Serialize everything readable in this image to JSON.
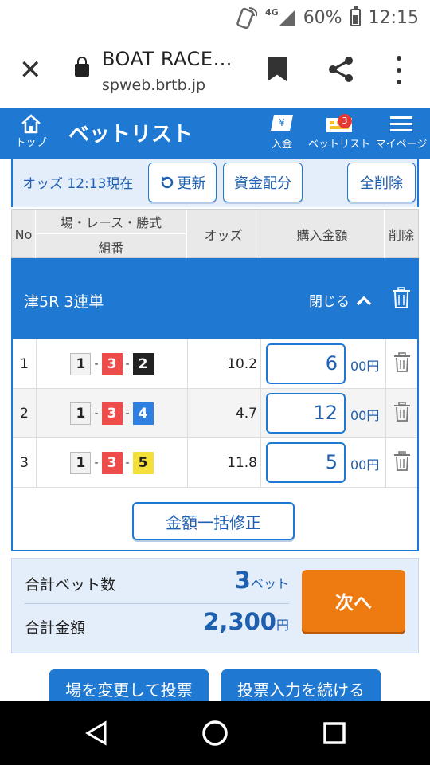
{
  "status_bar": {
    "network": "4G",
    "battery": "60%",
    "battery_level": 0.6,
    "time": "12:15"
  },
  "browser": {
    "title": "BOAT RACE…",
    "url": "spweb.brtb.jp"
  },
  "app_header": {
    "home_label": "トップ",
    "page_title": "ベットリスト",
    "deposit_label": "入金",
    "betlist_label": "ベットリスト",
    "betlist_badge": "3",
    "mypage_label": "マイページ"
  },
  "toolbar": {
    "odds_time": "オッズ 12:13現在",
    "refresh_label": "更新",
    "allocate_label": "資金配分",
    "delete_all_label": "全削除"
  },
  "table_header": {
    "no": "No",
    "race_bet": "場・レース・勝式",
    "combo": "組番",
    "odds": "オッズ",
    "amount": "購入金額",
    "delete": "削除"
  },
  "group": {
    "title": "津5R 3連単",
    "close_label": "閉じる",
    "rows": [
      {
        "no": "1",
        "b1": "1",
        "b2": "3",
        "b3": "2",
        "odds": "10.2",
        "amount": "6",
        "unit": "00円"
      },
      {
        "no": "2",
        "b1": "1",
        "b2": "3",
        "b3": "4",
        "odds": "4.7",
        "amount": "12",
        "unit": "00円"
      },
      {
        "no": "3",
        "b1": "1",
        "b2": "3",
        "b3": "5",
        "odds": "11.8",
        "amount": "5",
        "unit": "00円"
      }
    ],
    "dash": "-",
    "bulk_label": "金額一括修正"
  },
  "boat_colors": {
    "1": "#f2f2f2",
    "2": "#222222",
    "3": "#ee4b4b",
    "4": "#2f7fe0",
    "5": "#f4e03a"
  },
  "summary": {
    "bet_count_label": "合計ベット数",
    "bet_count_value": "3",
    "bet_count_unit": "ベット",
    "total_label": "合計金額",
    "total_value": "2,300",
    "total_unit": "円",
    "next_label": "次へ"
  },
  "bottom_buttons": {
    "change_venue": "場を変更して投票",
    "continue_input": "投票入力を続ける"
  },
  "colors": {
    "primary": "#1f78d1",
    "accent": "#ee7a12"
  }
}
